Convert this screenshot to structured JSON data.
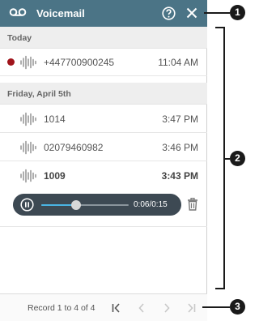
{
  "header": {
    "title": "Voicemail"
  },
  "sections": [
    {
      "label": "Today"
    },
    {
      "label": "Friday, April 5th"
    }
  ],
  "rows": [
    {
      "number": "+447700900245",
      "time": "11:04 AM",
      "unread": true
    },
    {
      "number": "1014",
      "time": "3:47 PM",
      "unread": false
    },
    {
      "number": "02079460982",
      "time": "3:46 PM",
      "unread": false
    },
    {
      "number": "1009",
      "time": "3:43 PM",
      "unread": false,
      "selected": true
    }
  ],
  "player": {
    "progress_text": "0:06/0:15",
    "played_fraction": 0.4
  },
  "footer": {
    "record_text": "Record 1 to 4 of 4"
  },
  "callouts": [
    "1",
    "2",
    "3"
  ],
  "colors": {
    "header_bg": "#4b7486",
    "unread_dot": "#a0141b",
    "player_bg": "#3d4953",
    "progress_fill": "#4ab3e3"
  }
}
